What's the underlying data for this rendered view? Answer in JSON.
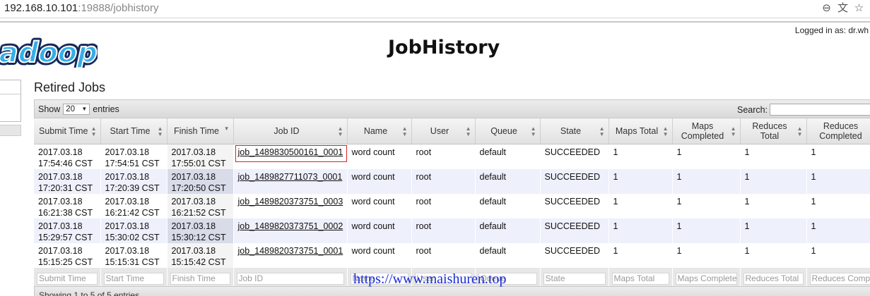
{
  "browser": {
    "url_host": "192.168.10.101",
    "url_rest": ":19888/jobhistory",
    "icons": [
      "zoom-out-icon",
      "translate-icon",
      "star-icon"
    ]
  },
  "header": {
    "logo_text": "adoop",
    "title": "JobHistory",
    "logged_in": "Logged in as: dr.wh"
  },
  "section": {
    "title": "Retired Jobs",
    "show_label": "Show",
    "page_size": "20",
    "entries_label": "entries",
    "search_label": "Search:"
  },
  "table": {
    "columns": [
      "Submit Time",
      "Start Time",
      "Finish Time",
      "Job ID",
      "Name",
      "User",
      "Queue",
      "State",
      "Maps Total",
      "Maps Completed",
      "Reduces Total",
      "Reduces Completed"
    ],
    "rows": [
      {
        "submit_date": "2017.03.18",
        "submit_time": "17:54:46 CST",
        "start_date": "2017.03.18",
        "start_time": "17:54:51 CST",
        "finish_date": "2017.03.18",
        "finish_time": "17:55:01 CST",
        "job_id": "job_1489830500161_0001",
        "name": "word count",
        "user": "root",
        "queue": "default",
        "state": "SUCCEEDED",
        "maps_total": "1",
        "maps_completed": "1",
        "reduces_total": "1",
        "reduces_completed": "1"
      },
      {
        "submit_date": "2017.03.18",
        "submit_time": "17:20:31 CST",
        "start_date": "2017.03.18",
        "start_time": "17:20:39 CST",
        "finish_date": "2017.03.18",
        "finish_time": "17:20:50 CST",
        "job_id": "job_1489827711073_0001",
        "name": "word count",
        "user": "root",
        "queue": "default",
        "state": "SUCCEEDED",
        "maps_total": "1",
        "maps_completed": "1",
        "reduces_total": "1",
        "reduces_completed": "1"
      },
      {
        "submit_date": "2017.03.18",
        "submit_time": "16:21:38 CST",
        "start_date": "2017.03.18",
        "start_time": "16:21:42 CST",
        "finish_date": "2017.03.18",
        "finish_time": "16:21:52 CST",
        "job_id": "job_1489820373751_0003",
        "name": "word count",
        "user": "root",
        "queue": "default",
        "state": "SUCCEEDED",
        "maps_total": "1",
        "maps_completed": "1",
        "reduces_total": "1",
        "reduces_completed": "1"
      },
      {
        "submit_date": "2017.03.18",
        "submit_time": "15:29:57 CST",
        "start_date": "2017.03.18",
        "start_time": "15:30:02 CST",
        "finish_date": "2017.03.18",
        "finish_time": "15:30:12 CST",
        "job_id": "job_1489820373751_0002",
        "name": "word count",
        "user": "root",
        "queue": "default",
        "state": "SUCCEEDED",
        "maps_total": "1",
        "maps_completed": "1",
        "reduces_total": "1",
        "reduces_completed": "1"
      },
      {
        "submit_date": "2017.03.18",
        "submit_time": "15:15:25 CST",
        "start_date": "2017.03.18",
        "start_time": "15:15:31 CST",
        "finish_date": "2017.03.18",
        "finish_time": "15:15:42 CST",
        "job_id": "job_1489820373751_0001",
        "name": "word count",
        "user": "root",
        "queue": "default",
        "state": "SUCCEEDED",
        "maps_total": "1",
        "maps_completed": "1",
        "reduces_total": "1",
        "reduces_completed": "1"
      }
    ],
    "filters": [
      "Submit Time",
      "Start Time",
      "Finish Time",
      "Job ID",
      "Name",
      "User",
      "Queue",
      "State",
      "Maps Total",
      "Maps Complete",
      "Reduces Total",
      "Reduces Comp"
    ]
  },
  "footer": {
    "info": "Showing 1 to 5 of 5 entries"
  },
  "watermark": "https://www.maishuren.top",
  "colors": {
    "even_row": "#eef0fb",
    "sorted_even": "#d8dbe8",
    "highlight_border": "#e02020",
    "watermark": "#1a2bd6"
  }
}
